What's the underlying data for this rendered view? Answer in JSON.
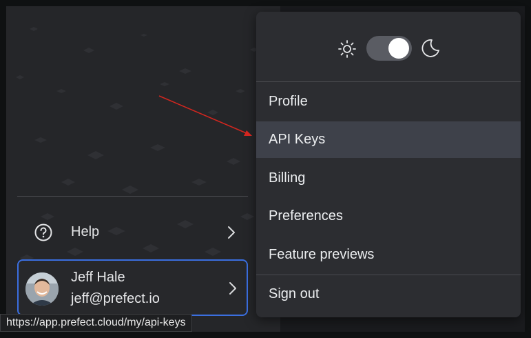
{
  "theme": {
    "light_icon": "sun-icon",
    "dark_icon": "moon-icon",
    "toggle_state": "light"
  },
  "menu": {
    "items": [
      {
        "label": "Profile"
      },
      {
        "label": "API Keys",
        "highlighted": true
      },
      {
        "label": "Billing"
      },
      {
        "label": "Preferences"
      },
      {
        "label": "Feature previews"
      },
      {
        "label": "Sign out"
      }
    ]
  },
  "sidebar": {
    "help": {
      "label": "Help",
      "icon": "question-circle-icon"
    },
    "user": {
      "name": "Jeff Hale",
      "email": "jeff@prefect.io",
      "avatar": "avatar"
    }
  },
  "status_bar": {
    "url": "https://app.prefect.cloud/my/api-keys"
  },
  "colors": {
    "accent_border": "#3b6fe0",
    "annotation_arrow": "#d4261f",
    "menu_bg": "#2c2d31",
    "active_item_bg": "#3e414a"
  }
}
